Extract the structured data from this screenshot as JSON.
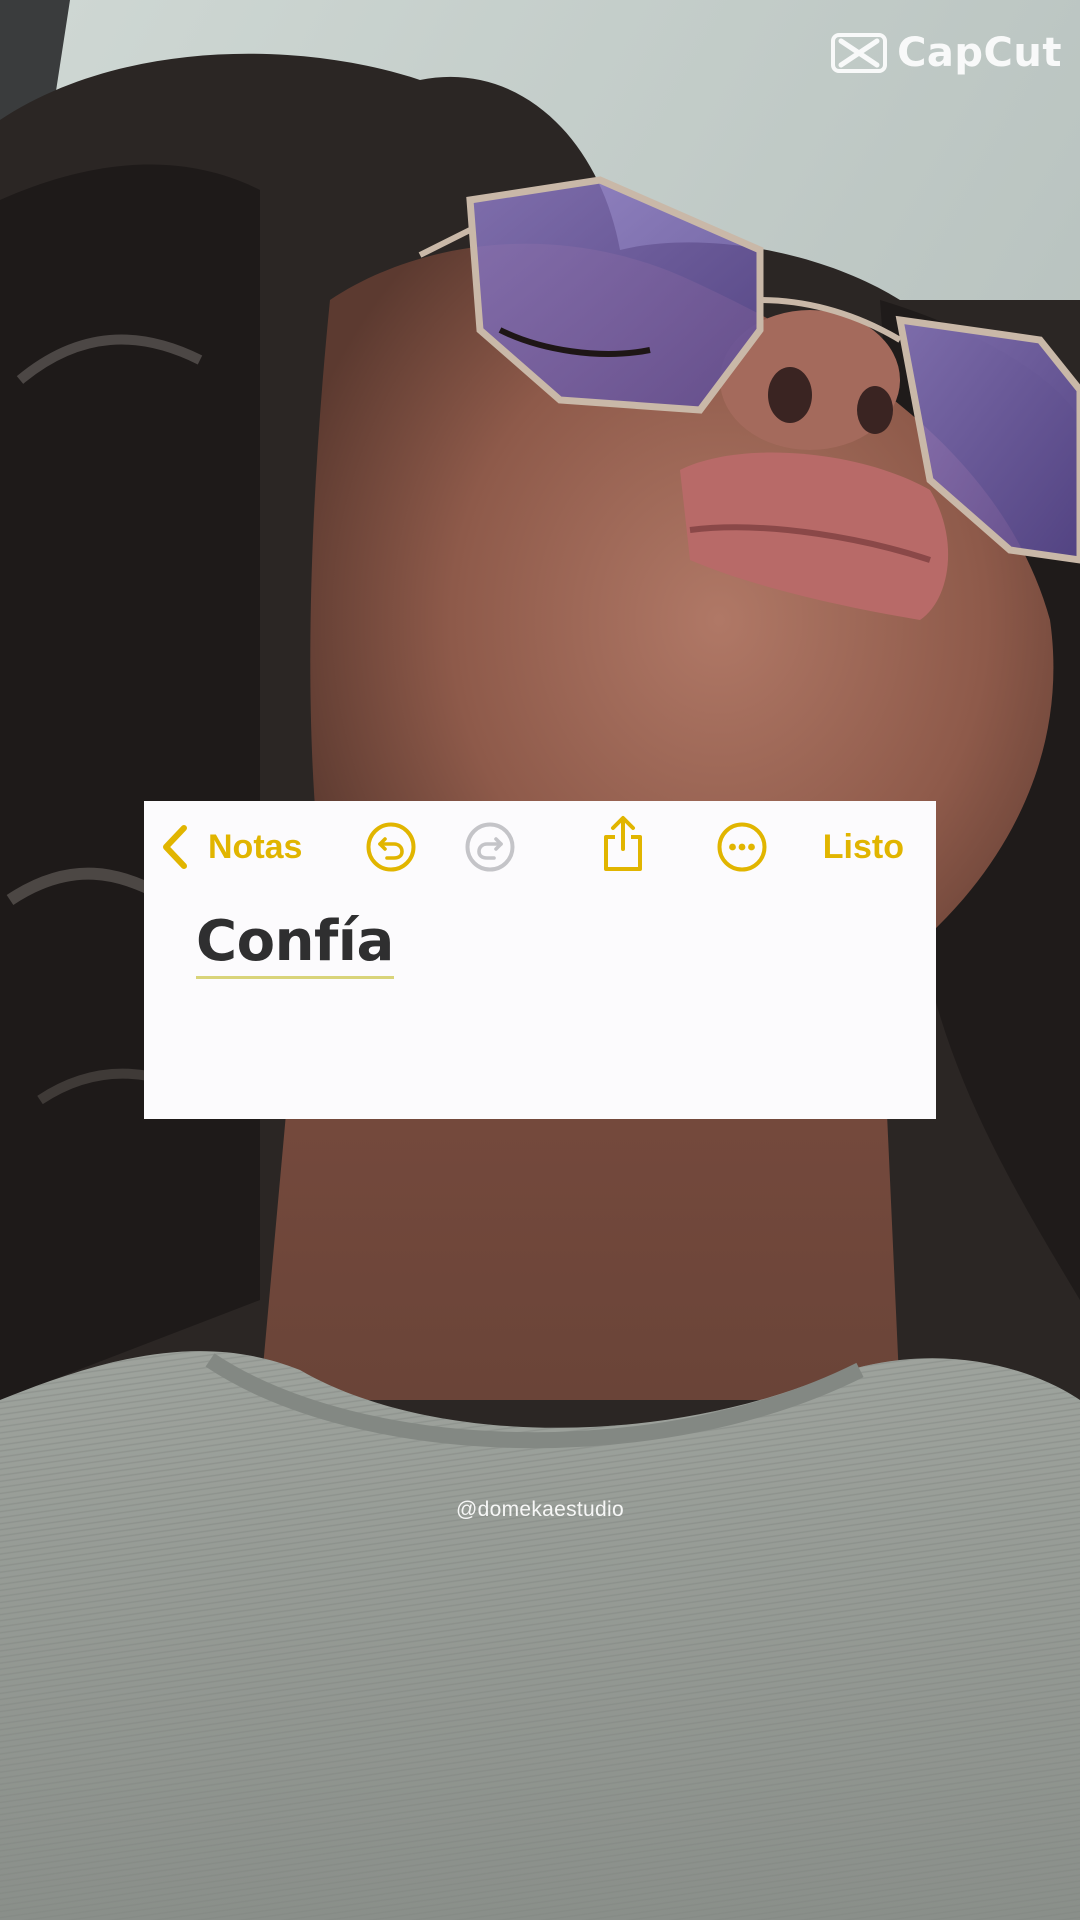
{
  "watermark": {
    "brand": "CapCut",
    "handle": "@domekaestudio"
  },
  "note": {
    "toolbar": {
      "back_label": "Notas",
      "done_label": "Listo",
      "icons": [
        "chevron-left-icon",
        "undo-icon",
        "redo-icon",
        "share-icon",
        "more-icon"
      ]
    },
    "title": "Confía"
  },
  "colors": {
    "accent": "#e1b500",
    "disabled": "#c4c4c8",
    "card_background": "#fcfbfd",
    "title_text": "#2f2f30"
  }
}
